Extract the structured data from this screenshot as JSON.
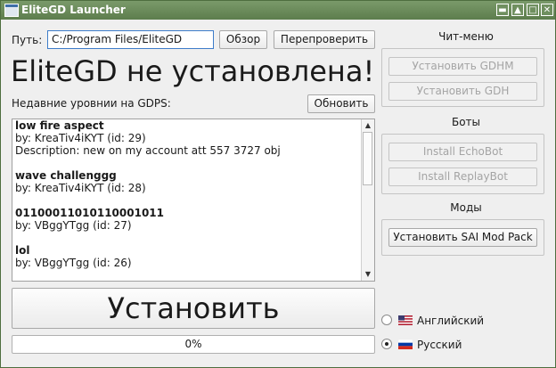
{
  "window": {
    "title": "EliteGD Launcher"
  },
  "path": {
    "label": "Путь:",
    "value": "C:/Program Files/EliteGD",
    "browse": "Обзор",
    "recheck": "Перепроверить"
  },
  "status_headline": "EliteGD не установлена!",
  "levels": {
    "label": "Недавние уровнии на GDPS:",
    "refresh": "Обновить",
    "items": [
      {
        "name": "low fire aspect",
        "by": "by: KreaTiv4iKYT (id: 29)",
        "desc": "Description: new on my account att 557 3727 obj"
      },
      {
        "name": "wave challenggg",
        "by": "by: KreaTiv4iKYT (id: 28)",
        "desc": ""
      },
      {
        "name": "01100011010110001011",
        "by": "by: VBggYTgg (id: 27)",
        "desc": ""
      },
      {
        "name": "lol",
        "by": "by: VBggYTgg (id: 26)",
        "desc": ""
      }
    ]
  },
  "install": {
    "label": "Установить",
    "progress_text": "0%",
    "progress": 0
  },
  "cheats": {
    "title": "Чит-меню",
    "install_gdhm": "Установить GDHM",
    "install_gdh": "Установить GDH"
  },
  "bots": {
    "title": "Боты",
    "install_echobot": "Install EchoBot",
    "install_replaybot": "Install ReplayBot"
  },
  "mods": {
    "title": "Моды",
    "install_sai": "Установить SAI Mod Pack"
  },
  "language": {
    "english": "Английский",
    "russian": "Русский",
    "selected": "russian"
  }
}
